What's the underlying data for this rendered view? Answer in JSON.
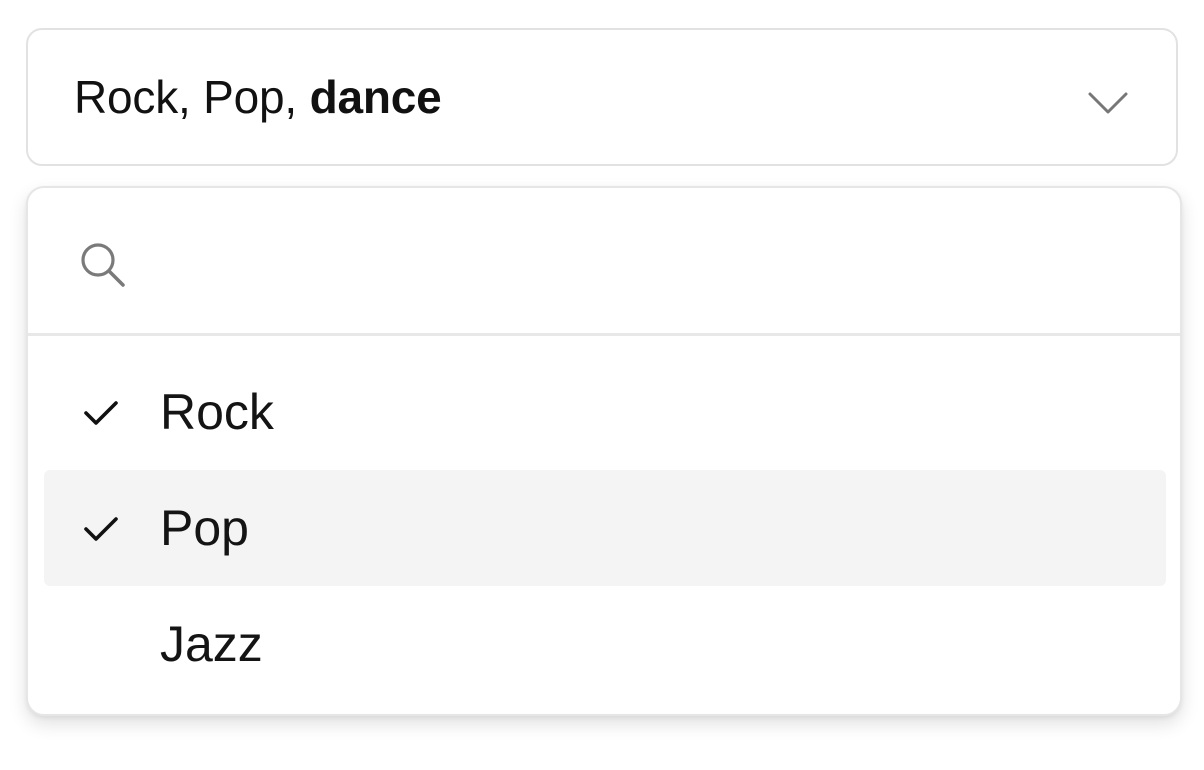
{
  "select": {
    "value_parts": [
      {
        "text": "Rock, Pop, ",
        "bold": false
      },
      {
        "text": "dance",
        "bold": true
      }
    ],
    "chevron_icon": "chevron-down-icon",
    "open": true
  },
  "dropdown": {
    "search": {
      "icon": "search-icon",
      "value": "",
      "placeholder": ""
    },
    "options": [
      {
        "label": "Rock",
        "checked": true,
        "highlighted": false
      },
      {
        "label": "Pop",
        "checked": true,
        "highlighted": true
      },
      {
        "label": "Jazz",
        "checked": false,
        "highlighted": false
      }
    ]
  },
  "colors": {
    "border": "#e2e2e2",
    "highlight_bg": "#f4f4f4",
    "text": "#111111",
    "icon_muted": "#777777"
  }
}
